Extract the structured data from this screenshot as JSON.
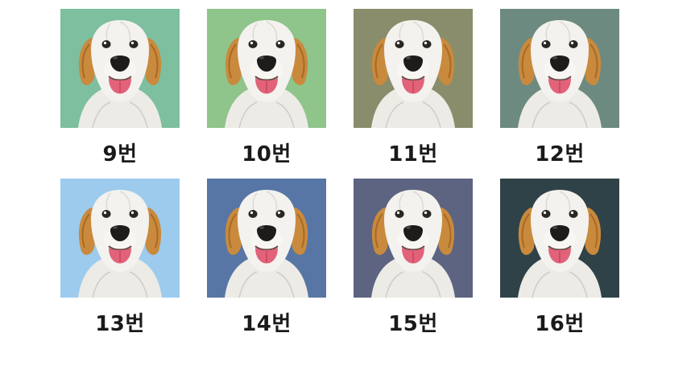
{
  "swatches": [
    {
      "label": "9번",
      "color": "#7dbf9f",
      "icon": "dog-portrait-icon"
    },
    {
      "label": "10번",
      "color": "#8fc48b",
      "icon": "dog-portrait-icon"
    },
    {
      "label": "11번",
      "color": "#8a8d6b",
      "icon": "dog-portrait-icon"
    },
    {
      "label": "12번",
      "color": "#6d8a80",
      "icon": "dog-portrait-icon"
    },
    {
      "label": "13번",
      "color": "#9ccbee",
      "icon": "dog-portrait-icon"
    },
    {
      "label": "14번",
      "color": "#5776a5",
      "icon": "dog-portrait-icon"
    },
    {
      "label": "15번",
      "color": "#5d6481",
      "icon": "dog-portrait-icon"
    },
    {
      "label": "16번",
      "color": "#2f4247",
      "icon": "dog-portrait-icon"
    }
  ]
}
